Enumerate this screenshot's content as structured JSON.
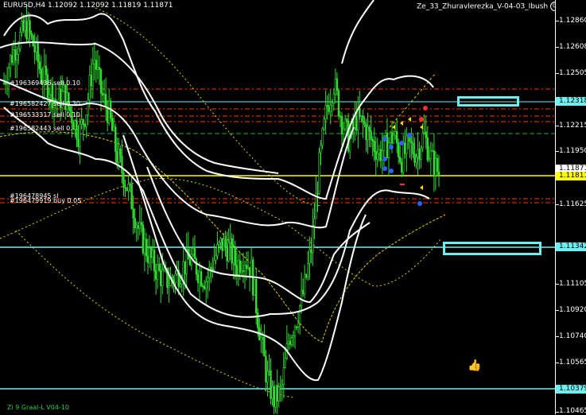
{
  "header": {
    "symbol_info": "EURUSD,H4  1.12092 1.12092 1.11819 1.11871",
    "expert_name": "Ze_33_Zhuravlerezka_V-04-03_Ibush",
    "smile_icon": "smiley-face-icon"
  },
  "price_scale": {
    "ticks": [
      "1.12860",
      "1.12608",
      "1.12505",
      "1.12215",
      "1.11950",
      "1.11625",
      "1.11105",
      "1.10920",
      "1.10740",
      "1.10565",
      "1.10465"
    ],
    "current_price": "1.11871",
    "bid_line_price": "1.11811",
    "level_upper": "1.12318",
    "level_middle": "1.11342",
    "level_lower": "1.10379"
  },
  "order_labels": [
    "#196369436 sell 0.10",
    "#196582427 sell 0.30",
    "#196533317 sell 0.10",
    "#196582443 sell 0.",
    "#196478945 sl",
    "#196479919 buy 0.05"
  ],
  "footer": {
    "indicator": "Zi 9 Graal-L V04-10"
  },
  "colors": {
    "candle": "#32dc32",
    "band": "#ffffff",
    "horizontal_cyan": "#6ef0f0",
    "current_line": "#ffff00",
    "order_line_red": "#ff3b00",
    "order_line_green": "#2ea84a"
  },
  "chart_data": {
    "type": "candlestick",
    "symbol": "EURUSD",
    "timeframe": "H4",
    "ylim": [
      1.1033,
      1.1298
    ],
    "horizontal_levels": [
      1.12318,
      1.11811,
      1.11342,
      1.10379
    ],
    "close_path": [
      1.1245,
      1.1262,
      1.1273,
      1.1281,
      1.1268,
      1.125,
      1.1243,
      1.1232,
      1.1238,
      1.1225,
      1.1212,
      1.1228,
      1.1262,
      1.1238,
      1.1225,
      1.12,
      1.1185,
      1.117,
      1.115,
      1.1138,
      1.1128,
      1.1121,
      1.1118,
      1.1122,
      1.1128,
      1.1133,
      1.1124,
      1.1119,
      1.1132,
      1.1142,
      1.1139,
      1.1128,
      1.1134,
      1.1125,
      1.109,
      1.1058,
      1.1042,
      1.1048,
      1.1082,
      1.1094,
      1.1112,
      1.114,
      1.119,
      1.1228,
      1.1245,
      1.1222,
      1.1208,
      1.1222,
      1.1218,
      1.1208,
      1.12,
      1.1205,
      1.1212,
      1.1196,
      1.1205,
      1.12,
      1.1212,
      1.1196,
      1.1187
    ]
  }
}
